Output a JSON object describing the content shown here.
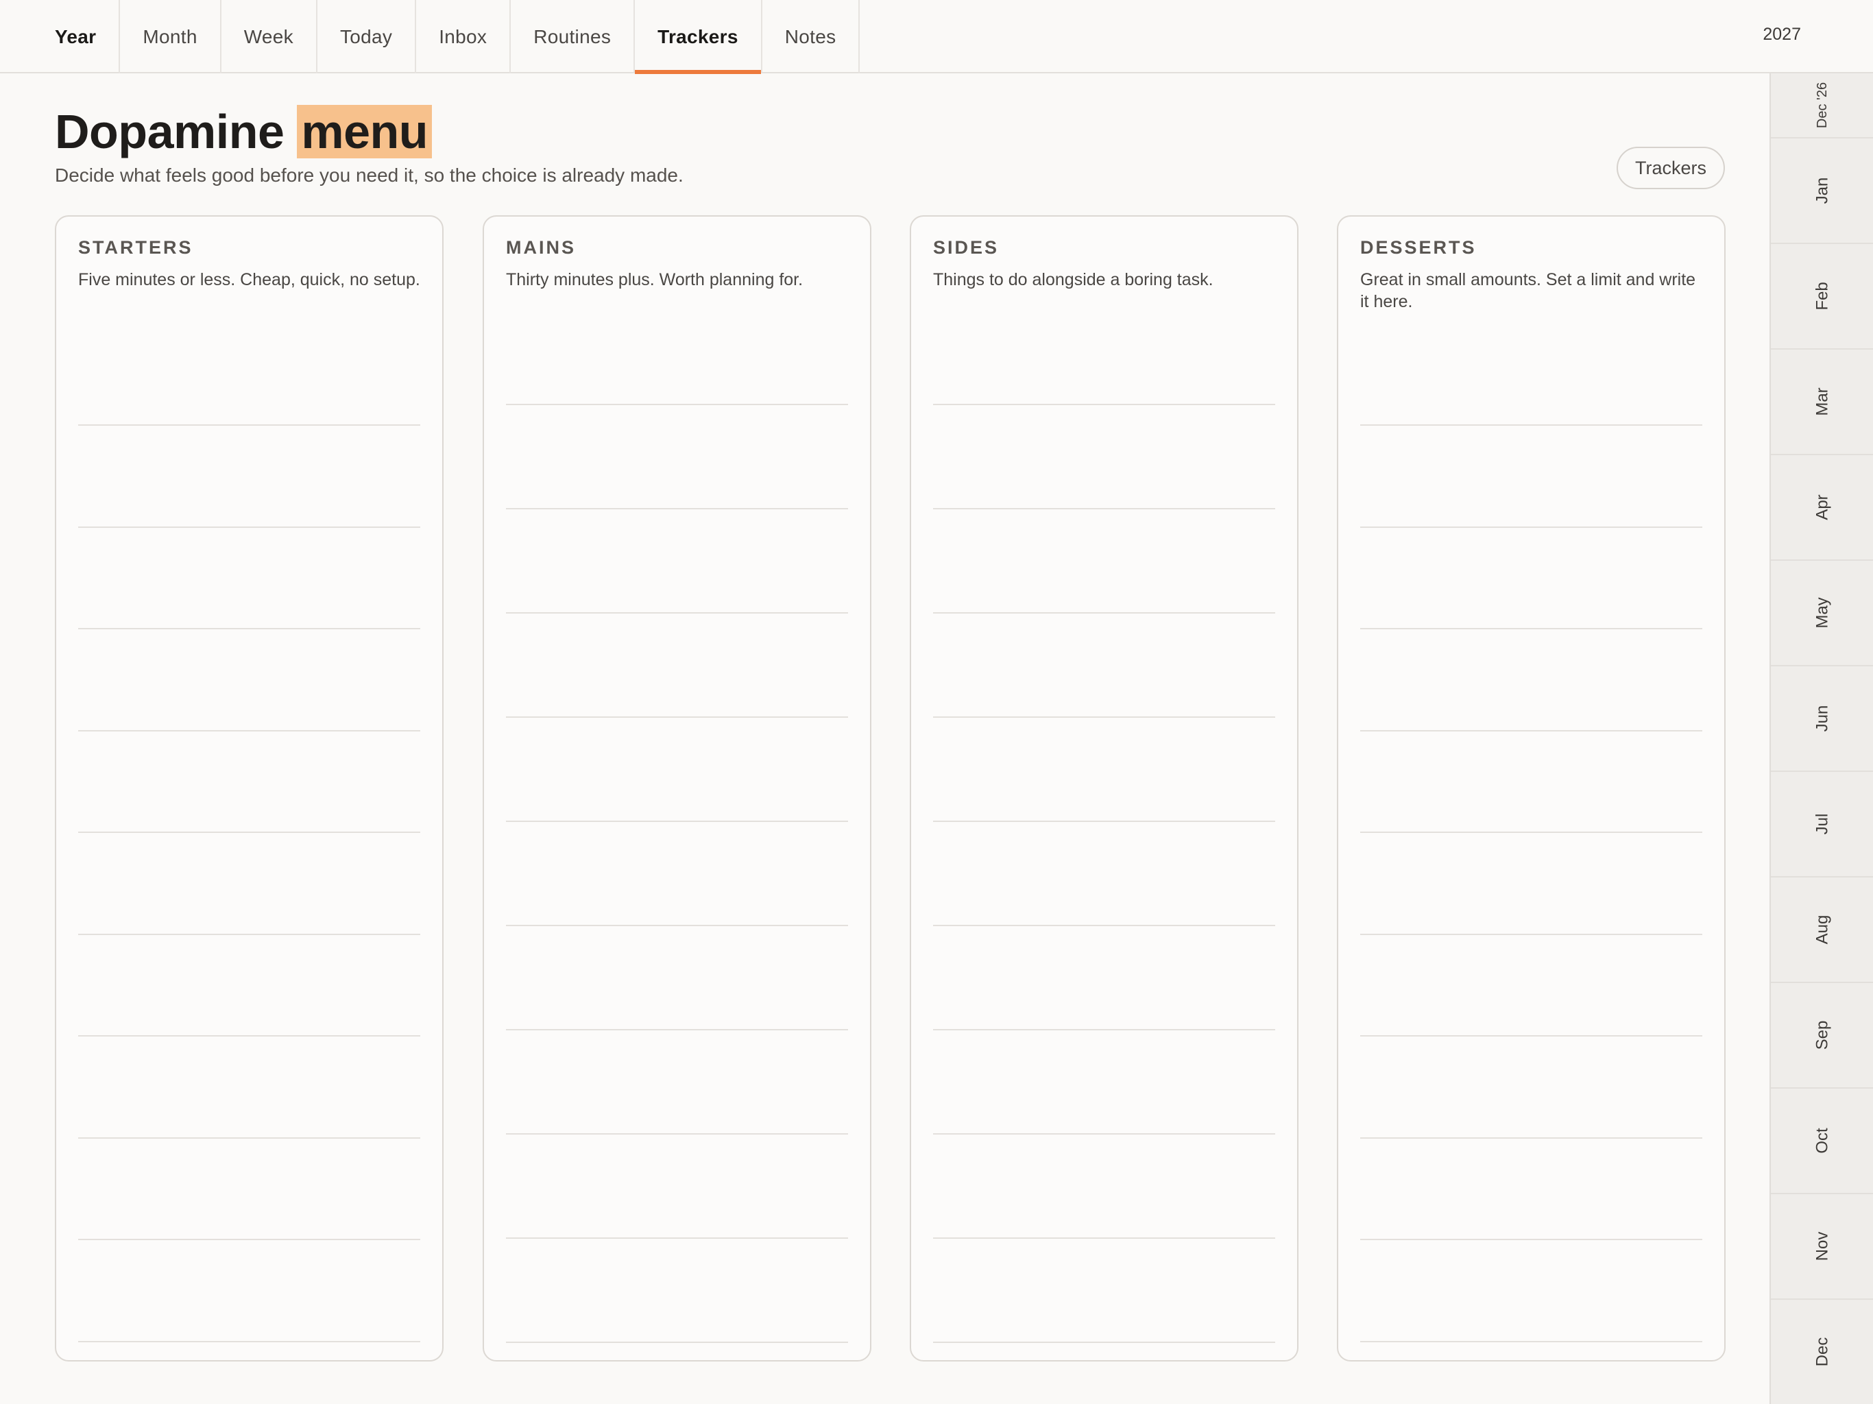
{
  "nav": {
    "tabs": [
      {
        "label": "Year"
      },
      {
        "label": "Month"
      },
      {
        "label": "Week"
      },
      {
        "label": "Today"
      },
      {
        "label": "Inbox"
      },
      {
        "label": "Routines"
      },
      {
        "label": "Trackers"
      },
      {
        "label": "Notes"
      }
    ],
    "active_tab": "Trackers",
    "accent_color": "#ed7a3c",
    "year": "2027"
  },
  "page": {
    "title_main": "Dopamine",
    "title_highlight": "menu",
    "highlight_color": "#f7c18c",
    "subtitle": "Decide what feels good before you need it, so the choice is already made.",
    "trackers_button": "Trackers"
  },
  "cards": [
    {
      "heading": "STARTERS",
      "description": "Five minutes or less. Cheap, quick, no setup.",
      "blank_lines": 10
    },
    {
      "heading": "MAINS",
      "description": "Thirty minutes plus. Worth planning for.",
      "blank_lines": 10
    },
    {
      "heading": "SIDES",
      "description": "Things to do alongside a boring task.",
      "blank_lines": 10
    },
    {
      "heading": "DESSERTS",
      "description": "Great in small amounts. Set a limit and write it here.",
      "blank_lines": 10
    }
  ],
  "month_rail": {
    "items": [
      "Dec '26",
      "Jan",
      "Feb",
      "Mar",
      "Apr",
      "May",
      "Jun",
      "Jul",
      "Aug",
      "Sep",
      "Oct",
      "Nov",
      "Dec"
    ]
  }
}
